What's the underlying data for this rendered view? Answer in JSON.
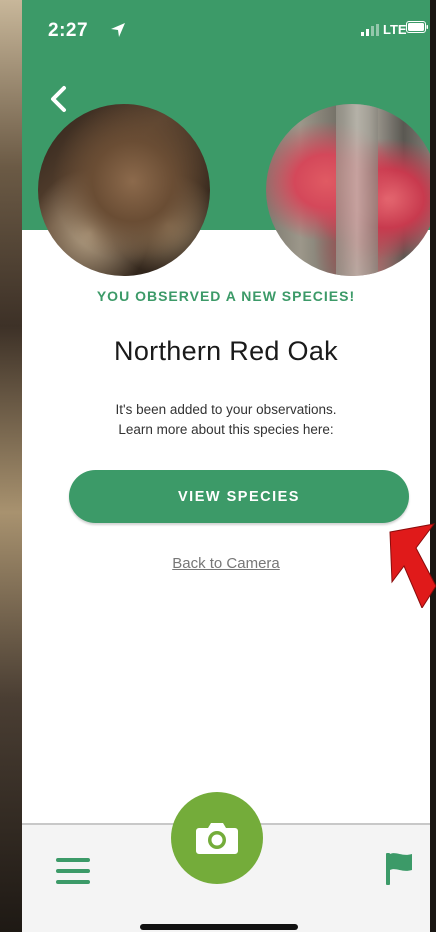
{
  "status_bar": {
    "time": "2:27",
    "network": "LTE",
    "icons": [
      "location-arrow-icon",
      "signal-icon",
      "battery-icon"
    ]
  },
  "header": {
    "back_icon": "chevron-left-icon",
    "photos": [
      "observed-photo",
      "species-reference-photo"
    ]
  },
  "main": {
    "headline": "YOU OBSERVED A NEW SPECIES!",
    "species_name": "Northern Red Oak",
    "subtext_line1": "It's been added to your observations.",
    "subtext_line2": "Learn more about this species here:",
    "view_button_label": "VIEW SPECIES",
    "back_link": "Back to Camera"
  },
  "bottom_nav": {
    "items": [
      "menu-icon",
      "camera-icon",
      "flag-icon"
    ]
  },
  "colors": {
    "brand_green": "#3c9a68",
    "camera_green": "#74ac3a",
    "annotation_red": "#e01a1a"
  }
}
